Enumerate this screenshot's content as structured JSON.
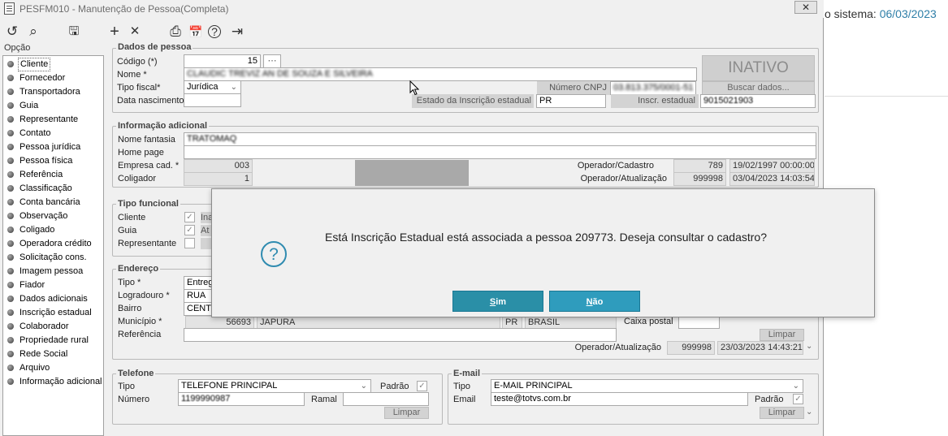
{
  "window": {
    "title": "PESFM010 - Manutenção de Pessoa(Completa)",
    "close_label": "✕"
  },
  "toolbar": {
    "icons": [
      "undo-icon",
      "search-icon",
      "save-icon",
      "add-icon",
      "delete-icon",
      "print-icon",
      "calendar-icon",
      "help-icon",
      "exit-icon"
    ],
    "glyphs": {
      "undo": "↺",
      "search": "⌕",
      "save": "🖫",
      "add": "+",
      "delete": "✕",
      "print": "⎙",
      "calendar": "📅",
      "help": "?",
      "exit": "⇥"
    }
  },
  "background_window": {
    "text_prefix": "o sistema: ",
    "date": "06/03/2023"
  },
  "nav": {
    "title": "Opção",
    "items": [
      "Cliente",
      "Fornecedor",
      "Transportadora",
      "Guia",
      "Representante",
      "Contato",
      "Pessoa jurídica",
      "Pessoa física",
      "Referência",
      "Classificação",
      "Conta bancária",
      "Observação",
      "Coligado",
      "Operadora crédito",
      "Solicitação cons.",
      "Imagem pessoa",
      "Fiador",
      "Dados adicionais",
      "Inscrição estadual",
      "Colaborador",
      "Propriedade rural",
      "Rede Social",
      "Arquivo",
      "Informação adicional"
    ]
  },
  "dados": {
    "title": "Dados de pessoa",
    "codigo_label": "Código (*)",
    "codigo_value": "15",
    "nome_label": "Nome *",
    "nome_value": "CLAUDIC TREVIZ AN DE SOUZA E SILVEIRA",
    "tipo_fiscal_label": "Tipo fiscal*",
    "tipo_fiscal_value": "Jurídica",
    "data_nasc_label": "Data nascimento",
    "status": "INATIVO",
    "cnpj_label": "Número CNPJ",
    "cnpj_value": "03.813.375/0001-51",
    "buscar_label": "Buscar dados...",
    "estado_ie_label": "Estado da Inscrição estadual",
    "estado_ie_value": "PR",
    "insc_label": "Inscr. estadual",
    "insc_value": "9015021903"
  },
  "info": {
    "title": "Informação adicional",
    "fantasia_label": "Nome fantasia",
    "fantasia_value": "TRATOMAQ",
    "homepage_label": "Home page",
    "empresa_label": "Empresa cad. *",
    "empresa_value": "003",
    "coligador_label": "Coligador",
    "coligador_value": "1",
    "op_cad_label": "Operador/Cadastro",
    "op_cad_id": "789",
    "op_cad_date": "19/02/1997 00:00:00",
    "op_atu_label": "Operador/Atualização",
    "op_atu_id": "999998",
    "op_atu_date": "03/04/2023 14:03:54"
  },
  "funcional": {
    "title": "Tipo funcional",
    "rows": [
      {
        "label": "Cliente",
        "checked": true,
        "tail": "Ina"
      },
      {
        "label": "Guia",
        "checked": true,
        "tail": "At"
      },
      {
        "label": "Representante",
        "checked": false,
        "tail": ""
      }
    ]
  },
  "endereco": {
    "title": "Endereço",
    "tipo_label": "Tipo *",
    "tipo_value": "Entreg",
    "logradouro_label": "Logradouro *",
    "logradouro_value": "RUA",
    "bairro_label": "Bairro",
    "bairro_value": "CENTR",
    "municipio_label": "Município *",
    "municipio_code": "56693",
    "municipio_name": "JAPURA",
    "uf": "PR",
    "pais": "BRASIL",
    "referencia_label": "Referência",
    "caixa_label": "Caixa postal",
    "limpar_label": "Limpar",
    "op_atu_label": "Operador/Atualização",
    "op_atu_id": "999998",
    "op_atu_date": "23/03/2023 14:43:21"
  },
  "telefone": {
    "title": "Telefone",
    "tipo_label": "Tipo",
    "tipo_value": "TELEFONE PRINCIPAL",
    "padrao_label": "Padrão",
    "numero_label": "Número",
    "numero_value": "1199990987",
    "ramal_label": "Ramal",
    "limpar_label": "Limpar"
  },
  "email": {
    "title": "E-mail",
    "tipo_label": "Tipo",
    "tipo_value": "E-MAIL PRINCIPAL",
    "email_label": "Email",
    "email_value": "teste@totvs.com.br",
    "padrao_label": "Padrão",
    "limpar_label": "Limpar"
  },
  "dialog": {
    "message": "Está Inscrição Estadual está associada a pessoa 209773. Deseja consultar o cadastro?",
    "icon": "?",
    "sim_first": "S",
    "sim_rest": "im",
    "nao_first": "N",
    "nao_rest": "ão"
  }
}
